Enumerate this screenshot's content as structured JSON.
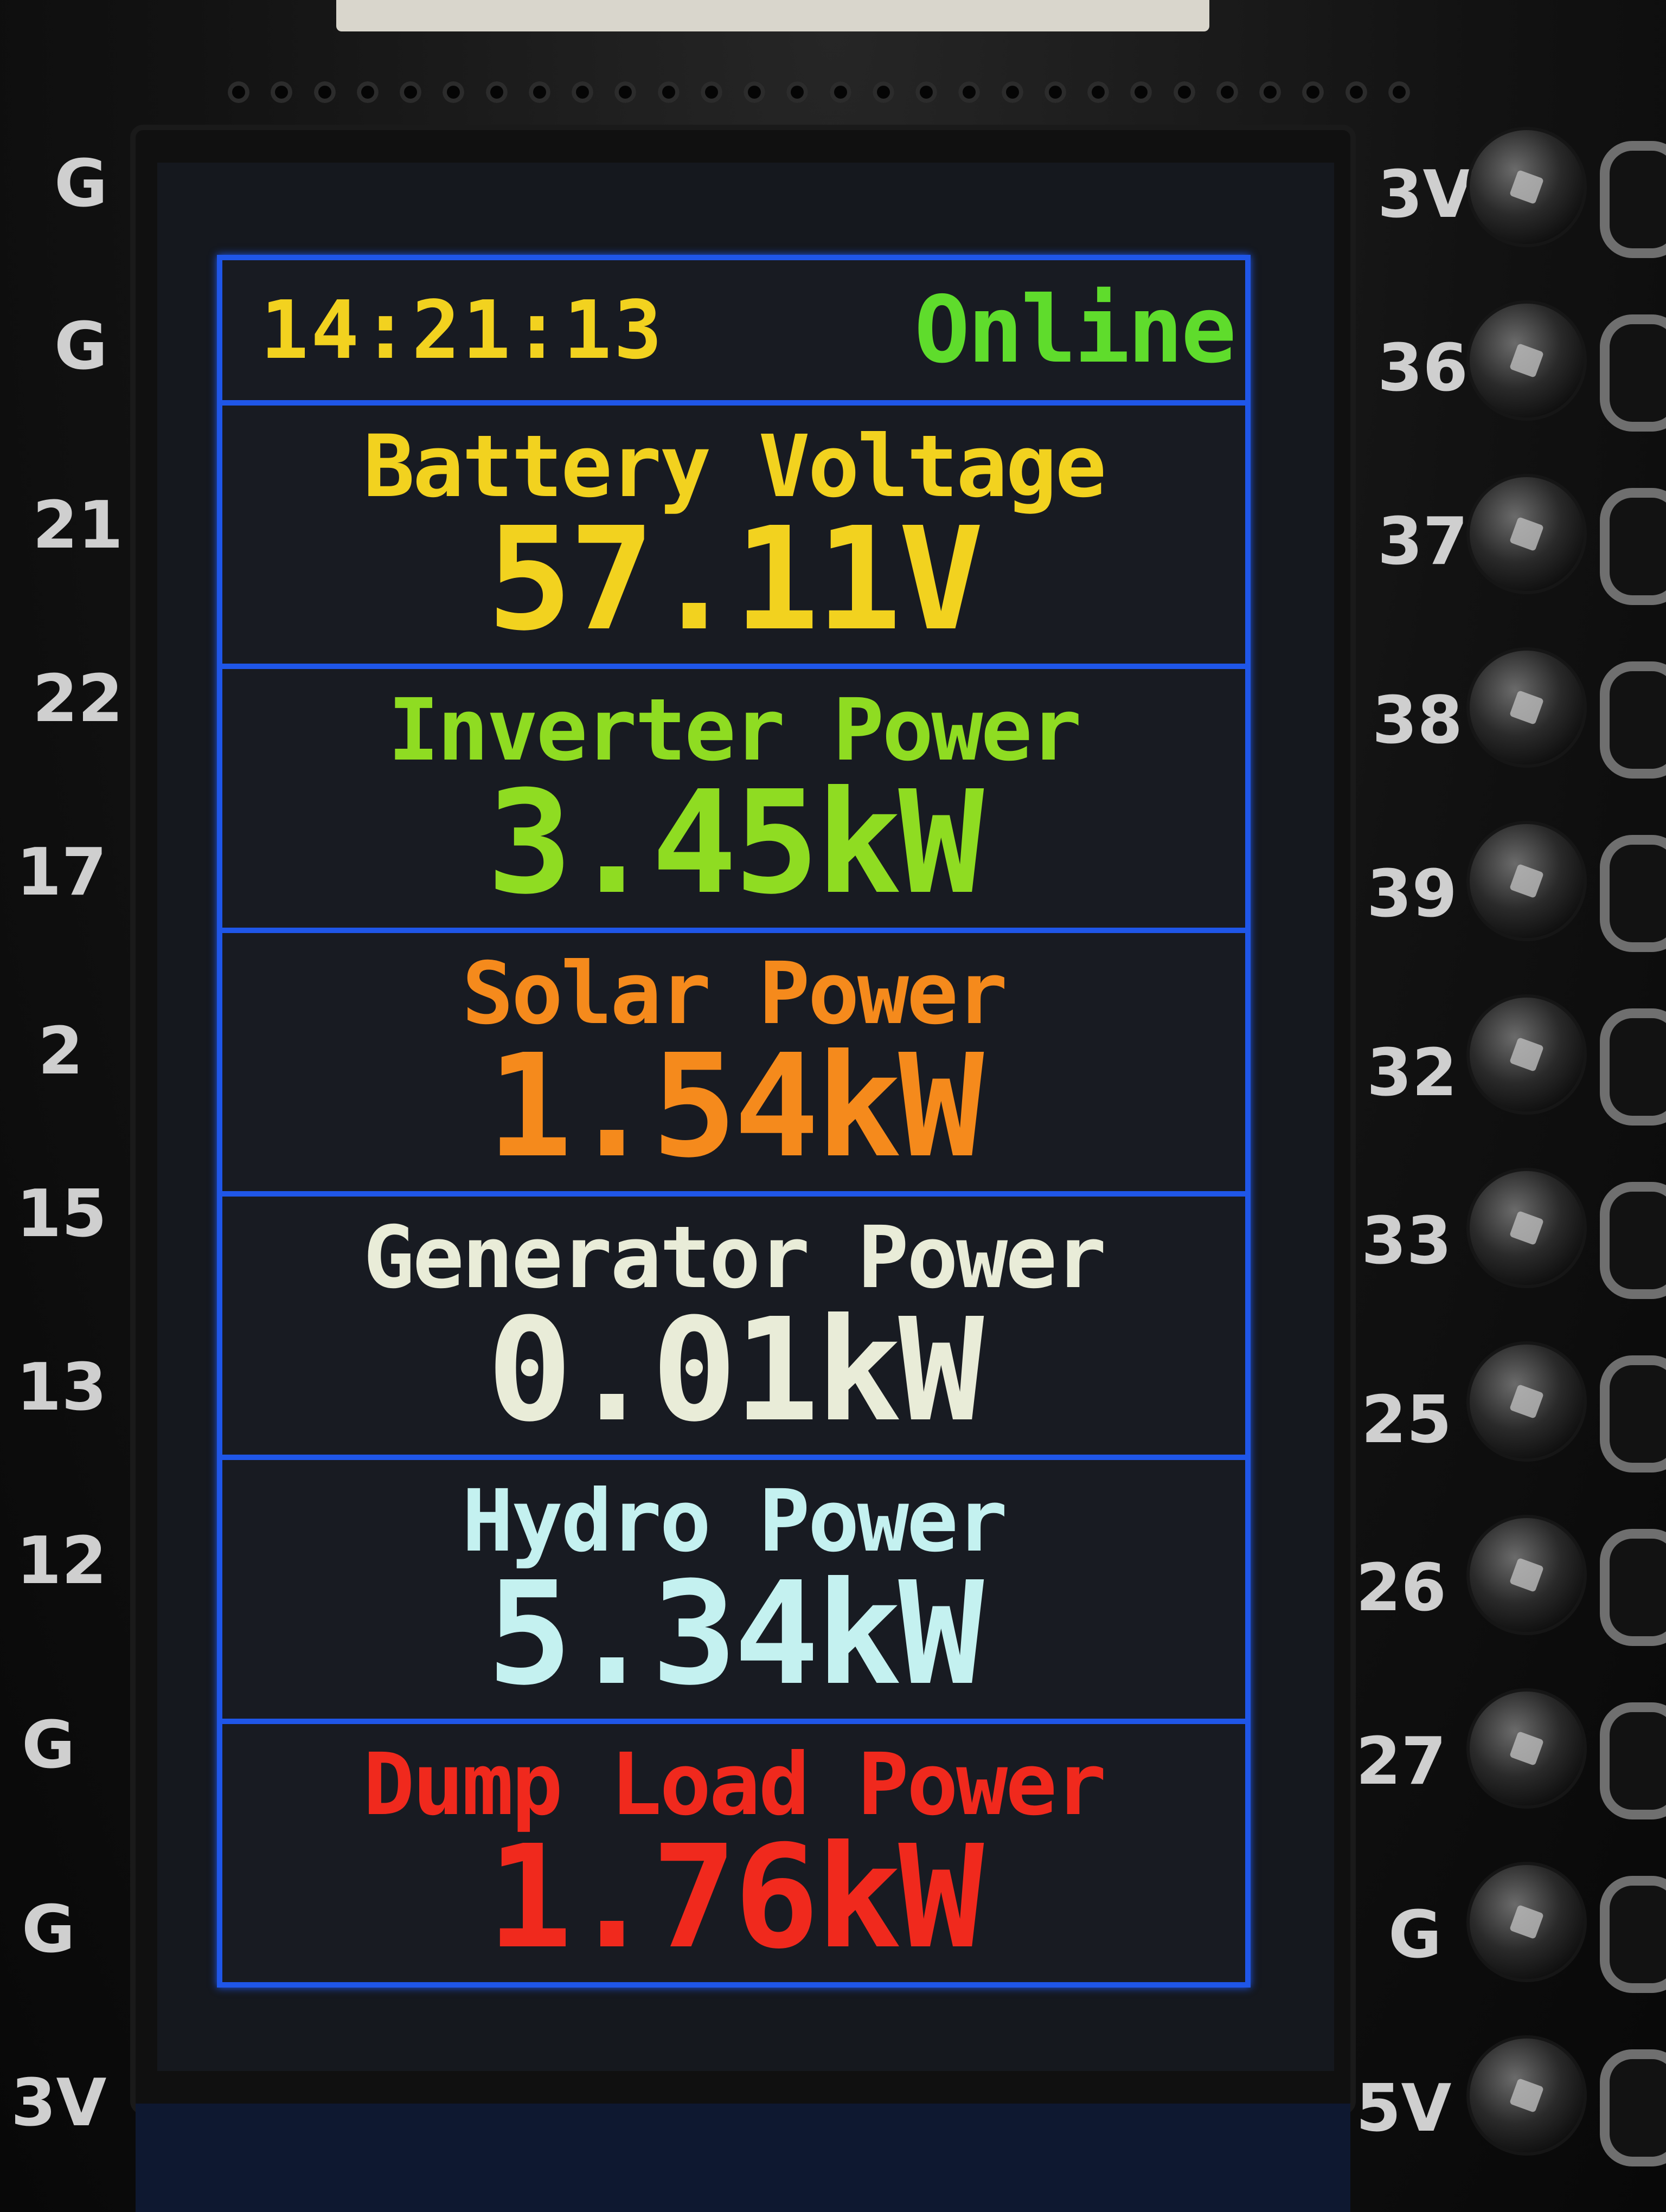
{
  "status_bar": {
    "time": "14:21:13",
    "status": "Online"
  },
  "readings": [
    {
      "label": "Battery Voltage",
      "value": "57.11V",
      "color": "#f2d21f"
    },
    {
      "label": "Inverter Power",
      "value": "3.45kW",
      "color": "#8fdc22"
    },
    {
      "label": "Solar Power",
      "value": "1.54kW",
      "color": "#f58a1c"
    },
    {
      "label": "Generator Power",
      "value": "0.01kW",
      "color": "#e9ecd8"
    },
    {
      "label": "Hydro Power",
      "value": "5.34kW",
      "color": "#c4f1f0"
    },
    {
      "label": "Dump Load Power",
      "value": "1.76kW",
      "color": "#f0291d"
    }
  ],
  "pins": {
    "left": [
      "G",
      "G",
      "21",
      "22",
      "17",
      "2",
      "15",
      "13",
      "12",
      "G",
      "G",
      "3V"
    ],
    "right": [
      "3V",
      "36",
      "37",
      "38",
      "39",
      "32",
      "33",
      "25",
      "26",
      "27",
      "G",
      "5V"
    ]
  },
  "colors": {
    "panel_border": "#1f56e8",
    "clock": "#f2d21f",
    "status_online": "#5fdc2c"
  }
}
